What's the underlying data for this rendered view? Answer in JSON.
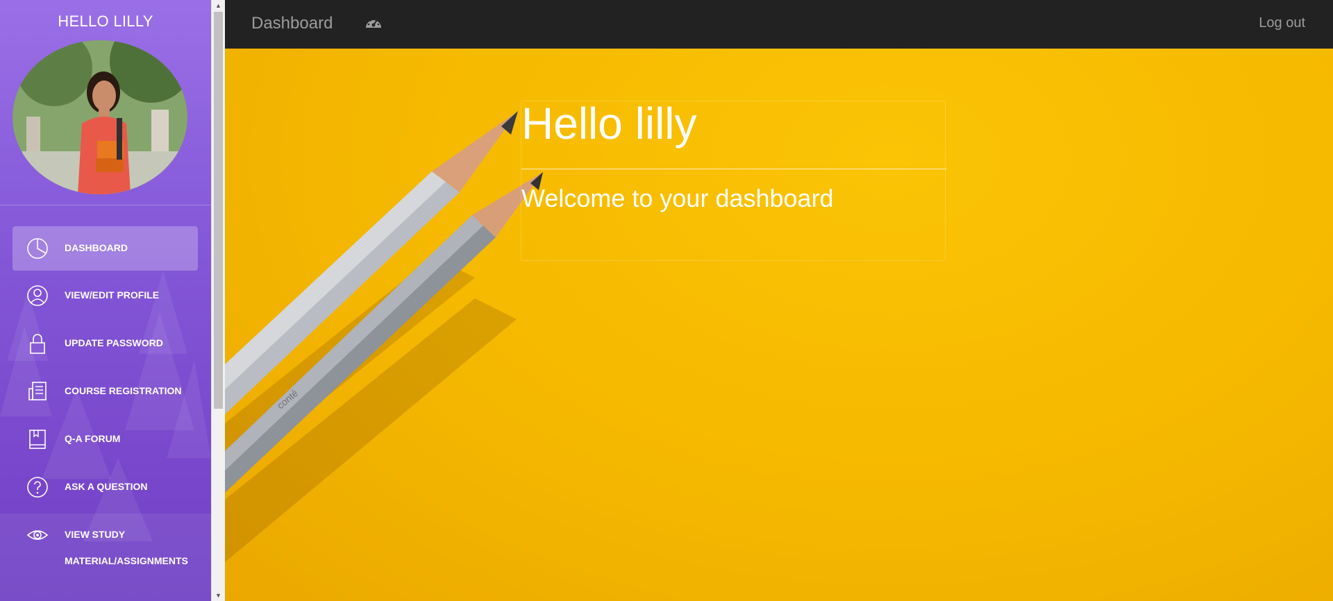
{
  "sidebar": {
    "greeting": "HELLO LILLY",
    "items": [
      {
        "label": "DASHBOARD",
        "icon": "pie-chart-icon",
        "active": true
      },
      {
        "label": "VIEW/EDIT PROFILE",
        "icon": "user-icon"
      },
      {
        "label": "UPDATE PASSWORD",
        "icon": "lock-icon"
      },
      {
        "label": "COURSE REGISTRATION",
        "icon": "document-icon"
      },
      {
        "label": "Q-A FORUM",
        "icon": "book-icon"
      },
      {
        "label": "ASK A QUESTION",
        "icon": "question-circle-icon"
      },
      {
        "label": "VIEW STUDY MATERIAL/ASSIGNMENTS",
        "icon": "eye-icon"
      }
    ]
  },
  "topbar": {
    "brand": "Dashboard",
    "brand_icon": "dashboard-gauge-icon",
    "logout": "Log out"
  },
  "main": {
    "title": "Hello lilly",
    "subtitle": "Welcome to your dashboard"
  },
  "colors": {
    "sidebar_top": "#9a6fe6",
    "sidebar_bottom": "#7040c4",
    "topbar": "#222222",
    "background": "#f5b800"
  }
}
